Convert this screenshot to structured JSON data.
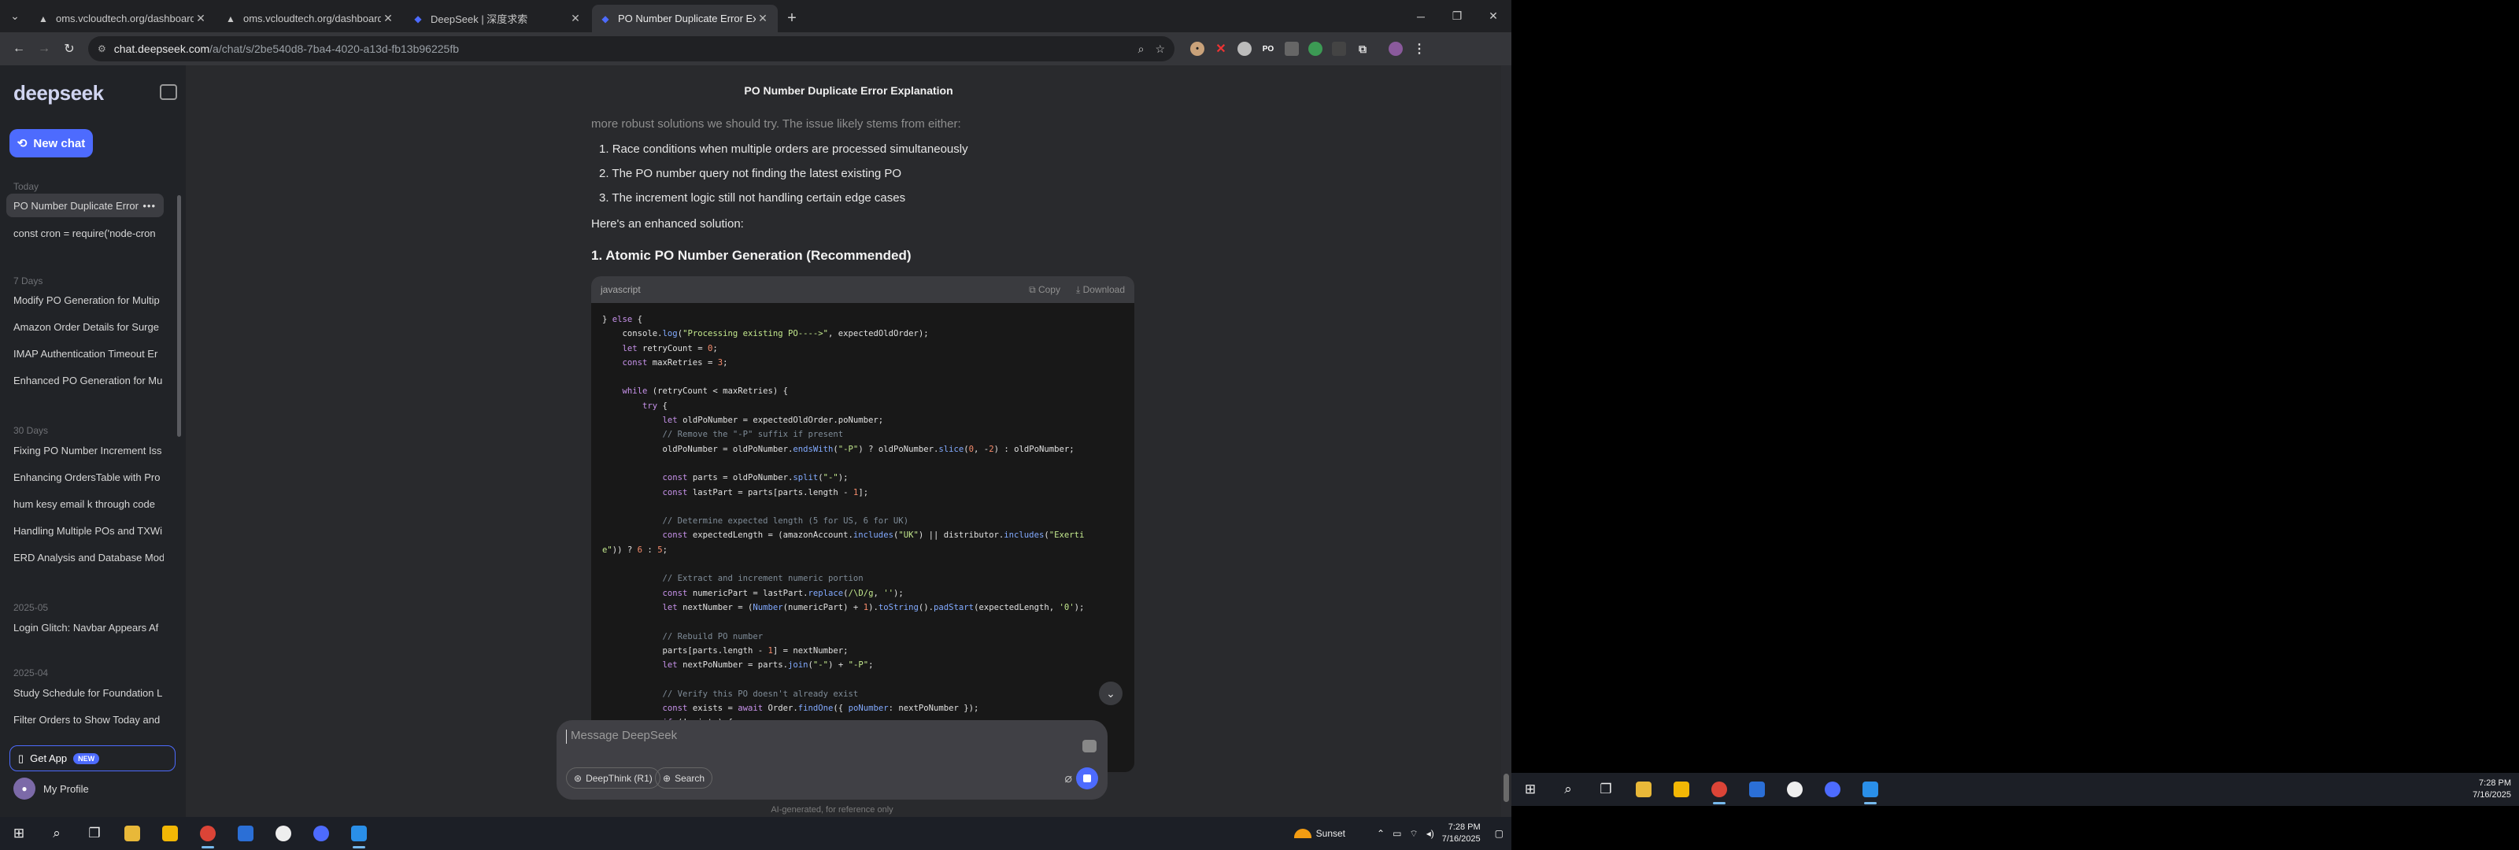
{
  "browser": {
    "tabs": [
      {
        "title": "oms.vcloudtech.org/dashboard",
        "active": false
      },
      {
        "title": "oms.vcloudtech.org/dashboard",
        "active": false
      },
      {
        "title": "DeepSeek | 深度求索",
        "active": false
      },
      {
        "title": "PO Number Duplicate Error Exp",
        "active": true
      }
    ],
    "url_host": "chat.deepseek.com",
    "url_path": "/a/chat/s/2be540d8-7ba4-4020-a13d-fb13b96225fb"
  },
  "sidebar": {
    "logo": "deepseek",
    "new_chat": "New chat",
    "sections": [
      {
        "label": "Today",
        "items": [
          "PO Number Duplicate Error",
          "const cron = require('node-cron"
        ]
      },
      {
        "label": "7 Days",
        "items": [
          "Modify PO Generation for Multip",
          "Amazon Order Details for Surge",
          "IMAP Authentication Timeout Er",
          "Enhanced PO Generation for Mu"
        ]
      },
      {
        "label": "30 Days",
        "items": [
          "Fixing PO Number Increment Iss",
          "Enhancing OrdersTable with Pro",
          "hum kesy email k through code",
          "Handling Multiple POs and TXWi",
          "ERD Analysis and Database Mod"
        ]
      },
      {
        "label": "2025-05",
        "items": [
          "Login Glitch: Navbar Appears Af"
        ]
      },
      {
        "label": "2025-04",
        "items": [
          "Study Schedule for Foundation L",
          "Filter Orders to Show Today and"
        ]
      }
    ],
    "get_app": "Get App",
    "new_badge": "NEW",
    "profile": "My Profile"
  },
  "chat": {
    "title": "PO Number Duplicate Error Explanation",
    "faded_line": "more robust solutions we should try. The issue likely stems from either:",
    "list": [
      "Race conditions when multiple orders are processed simultaneously",
      "The PO number query not finding the latest existing PO",
      "The increment logic still not handling certain edge cases"
    ],
    "intro": "Here's an enhanced solution:",
    "heading": "1. Atomic PO Number Generation (Recommended)",
    "code_lang": "javascript",
    "copy": "Copy",
    "download": "Download",
    "input_placeholder": "Message DeepSeek",
    "deepthink": "DeepThink (R1)",
    "search": "Search",
    "disclaimer": "AI-generated, for reference only"
  },
  "taskbar": {
    "weather": "Sunset",
    "time": "7:28 PM",
    "date": "7/16/2025"
  },
  "taskbar2": {
    "time": "7:28 PM",
    "date": "7/16/2025"
  }
}
